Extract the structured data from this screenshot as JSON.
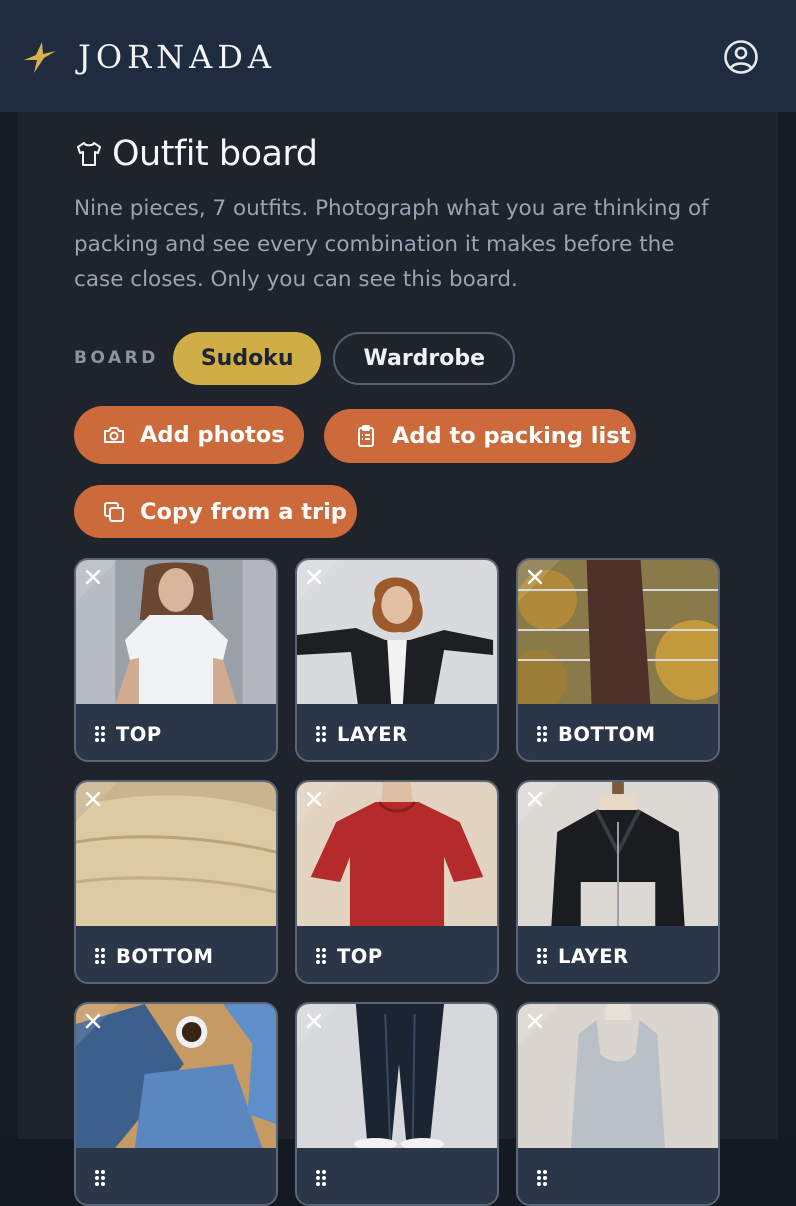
{
  "app": {
    "brand": "JORNADA",
    "logo_icon": "star-bird-icon",
    "account_icon": "user-circle-icon"
  },
  "page": {
    "title_icon": "shirt-icon",
    "title": "Outfit board",
    "description": "Nine pieces, 7 outfits. Photograph what you are thinking of packing and see every combination it makes before the case closes. Only you can see this board."
  },
  "board": {
    "label": "BOARD",
    "options": [
      {
        "label": "Sudoku",
        "selected": true
      },
      {
        "label": "Wardrobe",
        "selected": false
      }
    ]
  },
  "actions": {
    "add_photos": {
      "label": "Add photos",
      "icon": "camera-icon"
    },
    "add_to_packing_list": {
      "label": "Add to packing list",
      "icon": "clipboard-icon"
    },
    "copy_from_trip": {
      "label": "Copy from a trip",
      "icon": "copy-icon"
    }
  },
  "pieces": [
    {
      "label": "TOP",
      "photo": "white t-shirt"
    },
    {
      "label": "LAYER",
      "photo": "black blazer"
    },
    {
      "label": "BOTTOM",
      "photo": "brown skirt"
    },
    {
      "label": "BOTTOM",
      "photo": "beige lace skirt"
    },
    {
      "label": "TOP",
      "photo": "red t-shirt"
    },
    {
      "label": "LAYER",
      "photo": "black leather jacket"
    },
    {
      "label": "",
      "photo": "blue jeans and cardigan"
    },
    {
      "label": "",
      "photo": "black leggings"
    },
    {
      "label": "",
      "photo": "grey tank top"
    }
  ],
  "colors": {
    "accent_gold": "#cfad47",
    "accent_orange": "#cd6a3c",
    "topbar": "#1f2b3f"
  }
}
